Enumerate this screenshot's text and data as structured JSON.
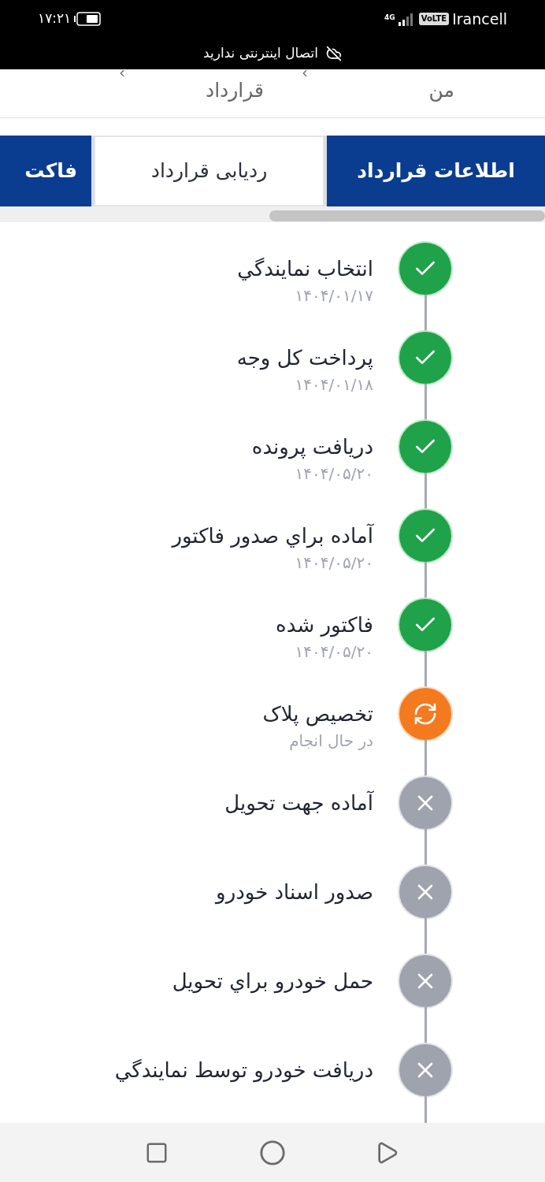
{
  "status_bar": {
    "time": "۱۷:۲۱",
    "network": "4G",
    "volte": "VoLTE",
    "carrier": "Irancell",
    "notice": "اتصال اینترنتی ندارید"
  },
  "breadcrumb": [
    {
      "label": "من"
    },
    {
      "label": "قرارداد"
    }
  ],
  "tabs": [
    {
      "label": "اطلاعات قرارداد",
      "selected": false
    },
    {
      "label": "ردیابی قرارداد",
      "selected": true
    },
    {
      "label": "فاکت",
      "selected": false
    }
  ],
  "steps": [
    {
      "title": "انتخاب نمايندگي",
      "subtitle": "۱۴۰۴/۰۱/۱۷",
      "kind": "done"
    },
    {
      "title": "پرداخت کل وجه",
      "subtitle": "۱۴۰۴/۰۱/۱۸",
      "kind": "done"
    },
    {
      "title": "دریافت پرونده",
      "subtitle": "۱۴۰۴/۰۵/۲۰",
      "kind": "done"
    },
    {
      "title": "آماده براي صدور فاکتور",
      "subtitle": "۱۴۰۴/۰۵/۲۰",
      "kind": "done"
    },
    {
      "title": "فاکتور شده",
      "subtitle": "۱۴۰۴/۰۵/۲۰",
      "kind": "done"
    },
    {
      "title": "تخصیص پلاک",
      "subtitle": "در حال انجام",
      "kind": "in_progress"
    },
    {
      "title": "آماده جهت تحویل",
      "kind": "pending"
    },
    {
      "title": "صدور اسناد خودرو",
      "kind": "pending"
    },
    {
      "title": "حمل خودرو براي تحویل",
      "kind": "pending"
    },
    {
      "title": "دریافت خودرو توسط نمايندگي",
      "kind": "pending"
    }
  ]
}
